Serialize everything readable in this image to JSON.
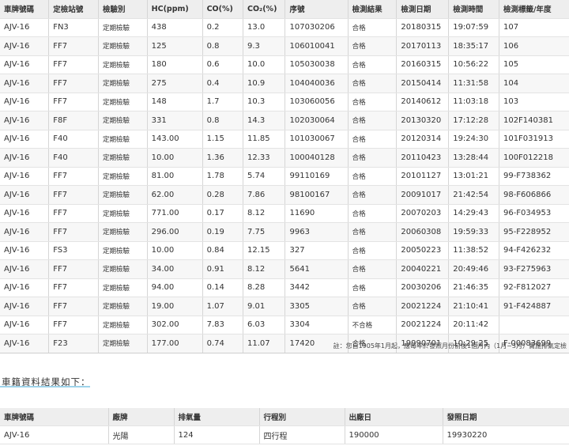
{
  "inspection": {
    "headers": [
      "車牌號碼",
      "定檢站號",
      "檢驗別",
      "HC(ppm)",
      "CO(%)",
      "CO₂(%)",
      "序號",
      "檢測結果",
      "檢測日期",
      "檢測時間",
      "檢測標籤/年度"
    ],
    "rows": [
      [
        "AJV-16",
        "FN3",
        "定期檢驗",
        "438",
        "0.2",
        "13.0",
        "107030206",
        "合格",
        "20180315",
        "19:07:59",
        "107"
      ],
      [
        "AJV-16",
        "FF7",
        "定期檢驗",
        "125",
        "0.8",
        "9.3",
        "106010041",
        "合格",
        "20170113",
        "18:35:17",
        "106"
      ],
      [
        "AJV-16",
        "FF7",
        "定期檢驗",
        "180",
        "0.6",
        "10.0",
        "105030038",
        "合格",
        "20160315",
        "10:56:22",
        "105"
      ],
      [
        "AJV-16",
        "FF7",
        "定期檢驗",
        "275",
        "0.4",
        "10.9",
        "104040036",
        "合格",
        "20150414",
        "11:31:58",
        "104"
      ],
      [
        "AJV-16",
        "FF7",
        "定期檢驗",
        "148",
        "1.7",
        "10.3",
        "103060056",
        "合格",
        "20140612",
        "11:03:18",
        "103"
      ],
      [
        "AJV-16",
        "F8F",
        "定期檢驗",
        "331",
        "0.8",
        "14.3",
        "102030064",
        "合格",
        "20130320",
        "17:12:28",
        "102F140381"
      ],
      [
        "AJV-16",
        "F40",
        "定期檢驗",
        "143.00",
        "1.15",
        "11.85",
        "101030067",
        "合格",
        "20120314",
        "19:24:30",
        "101F031913"
      ],
      [
        "AJV-16",
        "F40",
        "定期檢驗",
        "10.00",
        "1.36",
        "12.33",
        "100040128",
        "合格",
        "20110423",
        "13:28:44",
        "100F012218"
      ],
      [
        "AJV-16",
        "FF7",
        "定期檢驗",
        "81.00",
        "1.78",
        "5.74",
        "99110169",
        "合格",
        "20101127",
        "13:01:21",
        "99-F738362"
      ],
      [
        "AJV-16",
        "FF7",
        "定期檢驗",
        "62.00",
        "0.28",
        "7.86",
        "98100167",
        "合格",
        "20091017",
        "21:42:54",
        "98-F606866"
      ],
      [
        "AJV-16",
        "FF7",
        "定期檢驗",
        "771.00",
        "0.17",
        "8.12",
        "11690",
        "合格",
        "20070203",
        "14:29:43",
        "96-F034953"
      ],
      [
        "AJV-16",
        "FF7",
        "定期檢驗",
        "296.00",
        "0.19",
        "7.75",
        "9963",
        "合格",
        "20060308",
        "19:59:33",
        "95-F228952"
      ],
      [
        "AJV-16",
        "FS3",
        "定期檢驗",
        "10.00",
        "0.84",
        "12.15",
        "327",
        "合格",
        "20050223",
        "11:38:52",
        "94-F426232"
      ],
      [
        "AJV-16",
        "FF7",
        "定期檢驗",
        "34.00",
        "0.91",
        "8.12",
        "5641",
        "合格",
        "20040221",
        "20:49:46",
        "93-F275963"
      ],
      [
        "AJV-16",
        "FF7",
        "定期檢驗",
        "94.00",
        "0.14",
        "8.28",
        "3442",
        "合格",
        "20030206",
        "21:46:35",
        "92-F812027"
      ],
      [
        "AJV-16",
        "FF7",
        "定期檢驗",
        "19.00",
        "1.07",
        "9.01",
        "3305",
        "合格",
        "20021224",
        "21:10:41",
        "91-F424887"
      ],
      [
        "AJV-16",
        "FF7",
        "定期檢驗",
        "302.00",
        "7.83",
        "6.03",
        "3304",
        "不合格",
        "20021224",
        "20:11:42",
        ""
      ],
      [
        "AJV-16",
        "F23",
        "定期檢驗",
        "177.00",
        "0.74",
        "11.07",
        "17420",
        "合格",
        "19990701",
        "10:29:25",
        "F-00083699"
      ]
    ]
  },
  "note": "註：您自1905年1月起，應每年於發照月份前後1個月內（1月~3月）實施排氣定檢",
  "section_title": "車籍資料結果如下：",
  "registration": {
    "headers": [
      "車牌號碼",
      "廠牌",
      "排氣量",
      "行程別",
      "出廠日",
      "發照日期"
    ],
    "row": [
      "AJV-16",
      "光陽",
      "124",
      "四行程",
      "190000",
      "19930220"
    ]
  },
  "colors": {
    "header_bg": "#eeeeee",
    "stripe_bg": "#f7f7f7",
    "accent_underline": "#9ed3ea"
  }
}
